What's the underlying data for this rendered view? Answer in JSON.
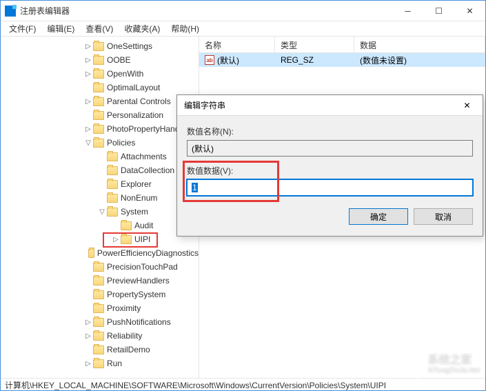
{
  "window": {
    "title": "注册表编辑器"
  },
  "menu": {
    "file": "文件(F)",
    "edit": "编辑(E)",
    "view": "查看(V)",
    "favorites": "收藏夹(A)",
    "help": "帮助(H)"
  },
  "tree": {
    "items": [
      {
        "indent": 120,
        "exp": "▷",
        "label": "OneSettings"
      },
      {
        "indent": 120,
        "exp": "▷",
        "label": "OOBE"
      },
      {
        "indent": 120,
        "exp": "▷",
        "label": "OpenWith"
      },
      {
        "indent": 120,
        "exp": "",
        "label": "OptimalLayout"
      },
      {
        "indent": 120,
        "exp": "▷",
        "label": "Parental Controls"
      },
      {
        "indent": 120,
        "exp": "",
        "label": "Personalization"
      },
      {
        "indent": 120,
        "exp": "▷",
        "label": "PhotoPropertyHandler"
      },
      {
        "indent": 120,
        "exp": "▽",
        "label": "Policies"
      },
      {
        "indent": 140,
        "exp": "",
        "label": "Attachments"
      },
      {
        "indent": 140,
        "exp": "",
        "label": "DataCollection"
      },
      {
        "indent": 140,
        "exp": "",
        "label": "Explorer"
      },
      {
        "indent": 140,
        "exp": "",
        "label": "NonEnum"
      },
      {
        "indent": 140,
        "exp": "▽",
        "label": "System"
      },
      {
        "indent": 160,
        "exp": "",
        "label": "Audit"
      },
      {
        "indent": 160,
        "exp": "▷",
        "label": "UIPI",
        "highlighted": true
      },
      {
        "indent": 120,
        "exp": "",
        "label": "PowerEfficiencyDiagnostics"
      },
      {
        "indent": 120,
        "exp": "",
        "label": "PrecisionTouchPad"
      },
      {
        "indent": 120,
        "exp": "",
        "label": "PreviewHandlers"
      },
      {
        "indent": 120,
        "exp": "",
        "label": "PropertySystem"
      },
      {
        "indent": 120,
        "exp": "",
        "label": "Proximity"
      },
      {
        "indent": 120,
        "exp": "▷",
        "label": "PushNotifications"
      },
      {
        "indent": 120,
        "exp": "▷",
        "label": "Reliability"
      },
      {
        "indent": 120,
        "exp": "",
        "label": "RetailDemo"
      },
      {
        "indent": 120,
        "exp": "▷",
        "label": "Run"
      }
    ]
  },
  "list": {
    "headers": {
      "name": "名称",
      "type": "类型",
      "data": "数据"
    },
    "row": {
      "icon": "ab",
      "name": "(默认)",
      "type": "REG_SZ",
      "data": "(数值未设置)"
    }
  },
  "dialog": {
    "title": "编辑字符串",
    "name_label": "数值名称(N):",
    "name_value": "(默认)",
    "data_label": "数值数据(V):",
    "data_value": "1",
    "ok": "确定",
    "cancel": "取消"
  },
  "statusbar": "计算机\\HKEY_LOCAL_MACHINE\\SOFTWARE\\Microsoft\\Windows\\CurrentVersion\\Policies\\System\\UIPI",
  "watermark": {
    "text1": "系统之家",
    "text2": "XiTongZhiJia.Net"
  }
}
